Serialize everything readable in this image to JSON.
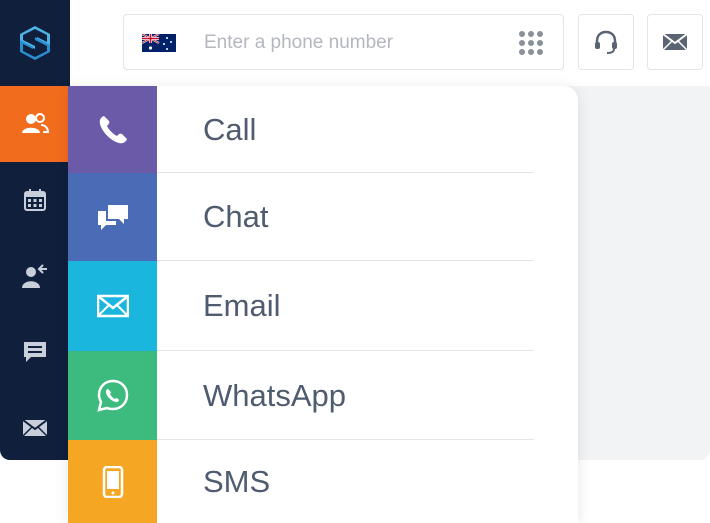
{
  "app": {
    "logo_icon": "s-logo-icon",
    "colors": {
      "sidebar_bg": "#0f1f3c",
      "sidebar_active": "#f26c1e",
      "content_bg": "#f2f3f5",
      "text": "#4f5b6e"
    }
  },
  "sidebar": {
    "items": [
      {
        "icon": "contacts-icon",
        "active": true
      },
      {
        "icon": "calendar-icon",
        "active": false
      },
      {
        "icon": "transfer-user-icon",
        "active": false
      },
      {
        "icon": "message-icon",
        "active": false
      },
      {
        "icon": "mail-icon",
        "active": false
      }
    ]
  },
  "topbar": {
    "phone_placeholder": "Enter a phone number",
    "country_flag_icon": "australia-flag-icon",
    "dialpad_icon": "dialpad-icon",
    "support_icon": "headset-icon",
    "mail_icon": "envelope-icon"
  },
  "menu": {
    "items": [
      {
        "label": "Call",
        "icon": "phone-icon",
        "color": "#6a5aa8"
      },
      {
        "label": "Chat",
        "icon": "chat-bubbles-icon",
        "color": "#4a6bb5"
      },
      {
        "label": "Email",
        "icon": "envelope-icon",
        "color": "#1bb6de"
      },
      {
        "label": "WhatsApp",
        "icon": "whatsapp-icon",
        "color": "#3dba7e"
      },
      {
        "label": "SMS",
        "icon": "mobile-phone-icon",
        "color": "#f5a623"
      }
    ]
  }
}
